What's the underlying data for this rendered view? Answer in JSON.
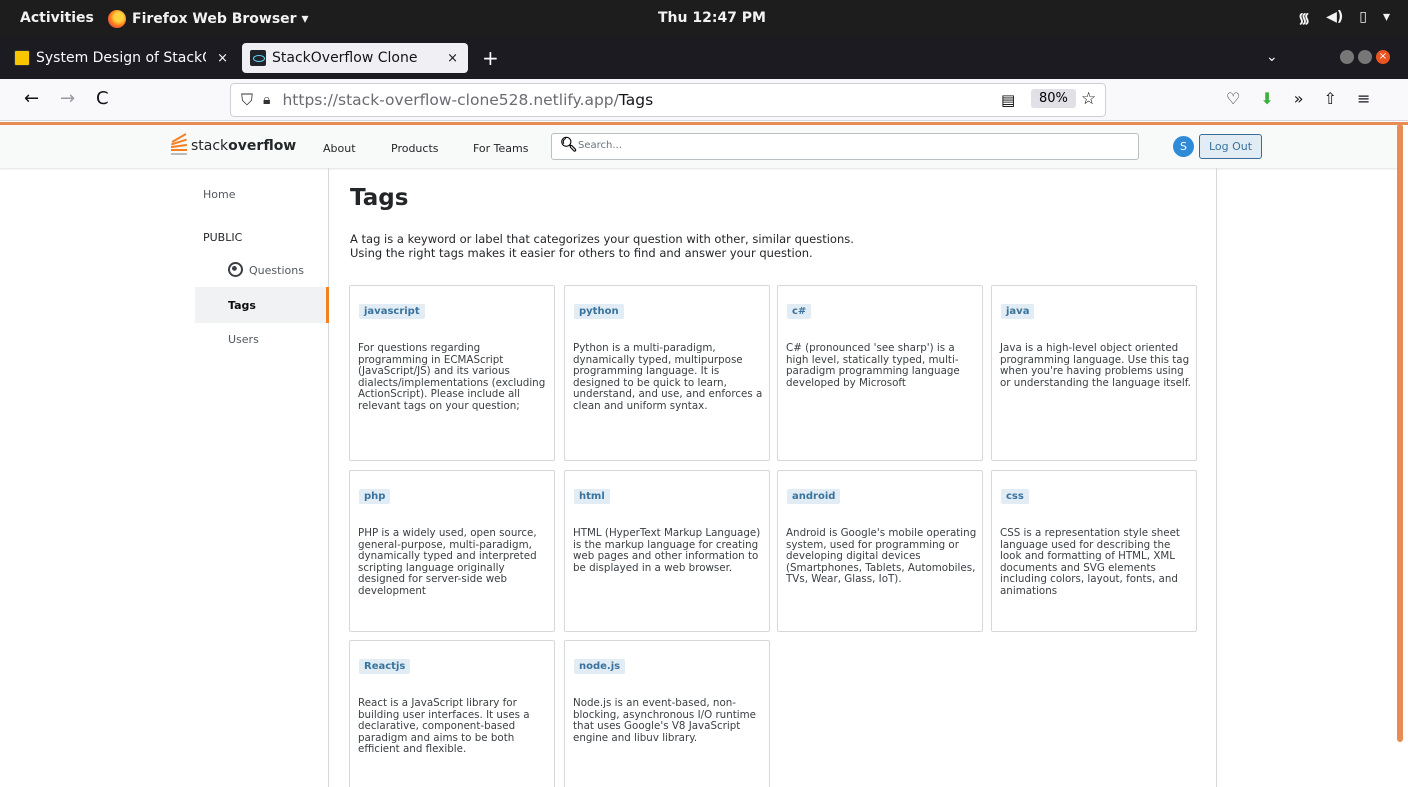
{
  "system": {
    "activities": "Activities",
    "app_name": "Firefox Web Browser ▾",
    "clock": "Thu 12:47 PM",
    "tray_icons": [
      "wifi-icon",
      "volume-icon",
      "battery-icon",
      "system-menu-icon"
    ]
  },
  "browser": {
    "tabs": [
      {
        "title": "System Design of StackOverflow",
        "close": "×",
        "favicon": "code-icon",
        "active": false
      },
      {
        "title": "StackOverflow Clone",
        "close": "×",
        "favicon": "react-icon",
        "active": true
      }
    ],
    "new_tab": "+",
    "list_tabs": "⌄",
    "nav": {
      "back": "←",
      "forward": "→",
      "reload": "C"
    },
    "url_host": "https://stack-overflow-clone528.netlify.app/",
    "url_path": "Tags",
    "zoom": "80%",
    "tools": {
      "pocket": "♡",
      "download": "⬇",
      "more": "»",
      "share": "⇧",
      "menu": "≡"
    }
  },
  "so_header": {
    "logo_plain": "stack",
    "logo_bold": "overflow",
    "links": [
      "About",
      "Products",
      "For Teams"
    ],
    "search_placeholder": "Search...",
    "avatar_initial": "S",
    "logout": "Log Out"
  },
  "sidebar": {
    "home": "Home",
    "public": "PUBLIC",
    "questions": "Questions",
    "tags": "Tags",
    "users": "Users",
    "active_item": "Tags"
  },
  "main": {
    "title": "Tags",
    "intro_line1": "A tag is a keyword or label that categorizes your question with other, similar questions.",
    "intro_line2": "Using the right tags makes it easier for others to find and answer your question.",
    "tags": [
      {
        "name": "javascript",
        "description": "For questions regarding programming in ECMAScript (JavaScript/JS) and its various dialects/implementations (excluding ActionScript). Please include all relevant tags on your question;"
      },
      {
        "name": "python",
        "description": "Python is a multi-paradigm, dynamically typed, multipurpose programming language. It is designed to be quick to learn, understand, and use, and enforces a clean and uniform syntax."
      },
      {
        "name": "c#",
        "description": "C# (pronounced 'see sharp') is a high level, statically typed, multi-paradigm programming language developed by Microsoft"
      },
      {
        "name": "java",
        "description": "Java is a high-level object oriented programming language. Use this tag when you're having problems using or understanding the language itself."
      },
      {
        "name": "php",
        "description": "PHP is a widely used, open source, general-purpose, multi-paradigm, dynamically typed and interpreted scripting language originally designed for server-side web development"
      },
      {
        "name": "html",
        "description": "HTML (HyperText Markup Language) is the markup language for creating web pages and other information to be displayed in a web browser."
      },
      {
        "name": "android",
        "description": "Android is Google's mobile operating system, used for programming or developing digital devices (Smartphones, Tablets, Automobiles, TVs, Wear, Glass, IoT)."
      },
      {
        "name": "css",
        "description": "CSS is a representation style sheet language used for describing the look and formatting of HTML, XML documents and SVG elements including colors, layout, fonts, and animations"
      },
      {
        "name": "Reactjs",
        "description": "React is a JavaScript library for building user interfaces. It uses a declarative, component-based paradigm and aims to be both efficient and flexible."
      },
      {
        "name": "node.js",
        "description": "Node.js is an event-based, non-blocking, asynchronous I/O runtime that uses Google's V8 JavaScript engine and libuv library."
      }
    ]
  },
  "colors": {
    "accent": "#f48024",
    "tag_bg": "#e1ecf4",
    "tag_text": "#39739d",
    "scrollbar": "#e98b55"
  }
}
